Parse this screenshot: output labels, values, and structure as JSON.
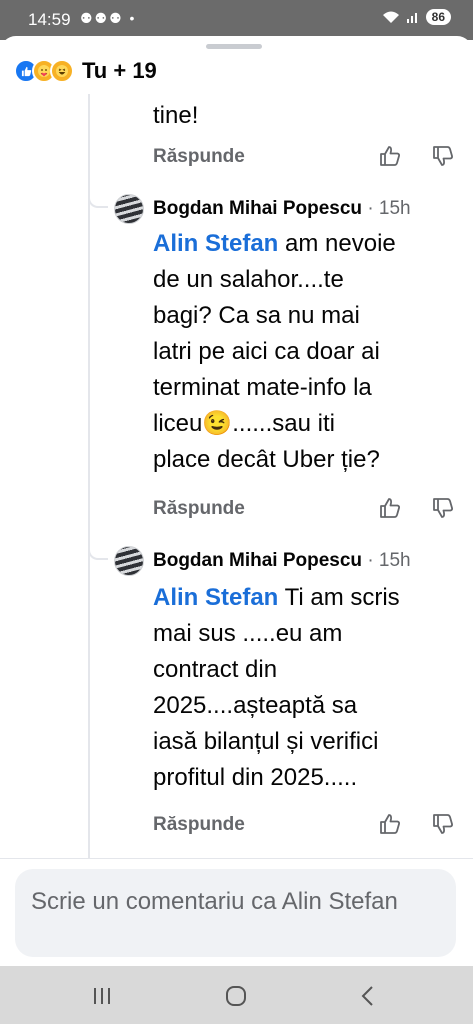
{
  "status_bar": {
    "time": "14:59",
    "notif_icons": "⚉⚉⚉ •",
    "battery": "86"
  },
  "reactions_header": {
    "icons": [
      "like-icon",
      "care-icon",
      "haha-icon"
    ],
    "text": "Tu + 19"
  },
  "comments": [
    {
      "partial": true,
      "text": "tine!",
      "reply_label": "Răspunde"
    },
    {
      "author": "Bogdan Mihai Popescu",
      "time": "· 15h",
      "mention": "Alin Stefan",
      "lines": [
        " am nevoie",
        "de un salahor....te",
        "bagi? Ca sa nu mai",
        "latri pe aici ca doar ai",
        "terminat mate-info la",
        "liceu😉......sau iti",
        "place decât Uber   ție?"
      ],
      "reply_label": "Răspunde"
    },
    {
      "author": "Bogdan Mihai Popescu",
      "time": "· 15h",
      "mention": "Alin Stefan",
      "lines": [
        " Ti am scris",
        "mai sus .....eu am",
        "contract din",
        "2025....așteaptă sa",
        "iasă bilanțul și verifici",
        "profitul din 2025....."
      ],
      "reply_label": "Răspunde"
    }
  ],
  "composer": {
    "placeholder": "Scrie un comentariu ca Alin Stefan"
  },
  "nav_bar": {
    "buttons": [
      "recent-apps-icon",
      "home-icon",
      "back-icon"
    ]
  },
  "colors": {
    "accent": "#1877f2",
    "mention": "#1a6ed8",
    "muted": "#65676b",
    "composer_bg": "#f0f2f5"
  }
}
